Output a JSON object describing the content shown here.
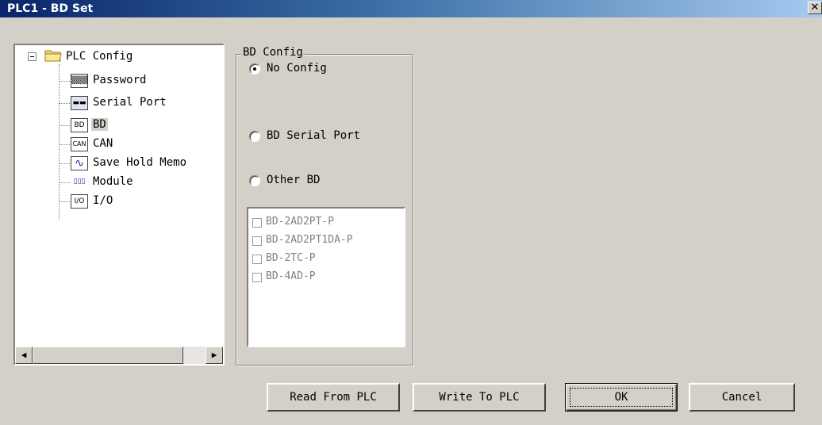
{
  "window": {
    "title": "PLC1 - BD Set",
    "close_glyph": "✕"
  },
  "tree": {
    "root_label": "PLC Config",
    "items": [
      {
        "label": "Password",
        "icon": "password-icon",
        "icon_text": "▒▒▒"
      },
      {
        "label": "Serial Port",
        "icon": "serial-port-icon",
        "icon_text": "▬▬"
      },
      {
        "label": "BD",
        "icon": "bd-icon",
        "icon_text": "BD",
        "selected": true
      },
      {
        "label": "CAN",
        "icon": "can-icon",
        "icon_text": "CAN"
      },
      {
        "label": "Save Hold Memo",
        "icon": "waveform-icon",
        "icon_text": "∿"
      },
      {
        "label": "Module",
        "icon": "module-icon",
        "icon_text": "▯▯▯"
      },
      {
        "label": "I/O",
        "icon": "io-icon",
        "icon_text": "I/O"
      }
    ]
  },
  "bd_config": {
    "group_label": "BD Config",
    "options": [
      {
        "label": "No Config",
        "checked": true
      },
      {
        "label": "BD Serial Port",
        "checked": false
      },
      {
        "label": "Other BD",
        "checked": false
      }
    ],
    "modules": [
      "BD-2AD2PT-P",
      "BD-2AD2PT1DA-P",
      "BD-2TC-P",
      "BD-4AD-P"
    ]
  },
  "buttons": {
    "read": "Read From PLC",
    "write": "Write To PLC",
    "ok": "OK",
    "cancel": "Cancel"
  },
  "colors": {
    "title_start": "#0a246a",
    "title_end": "#a6caf0",
    "face": "#d4d0c8"
  }
}
